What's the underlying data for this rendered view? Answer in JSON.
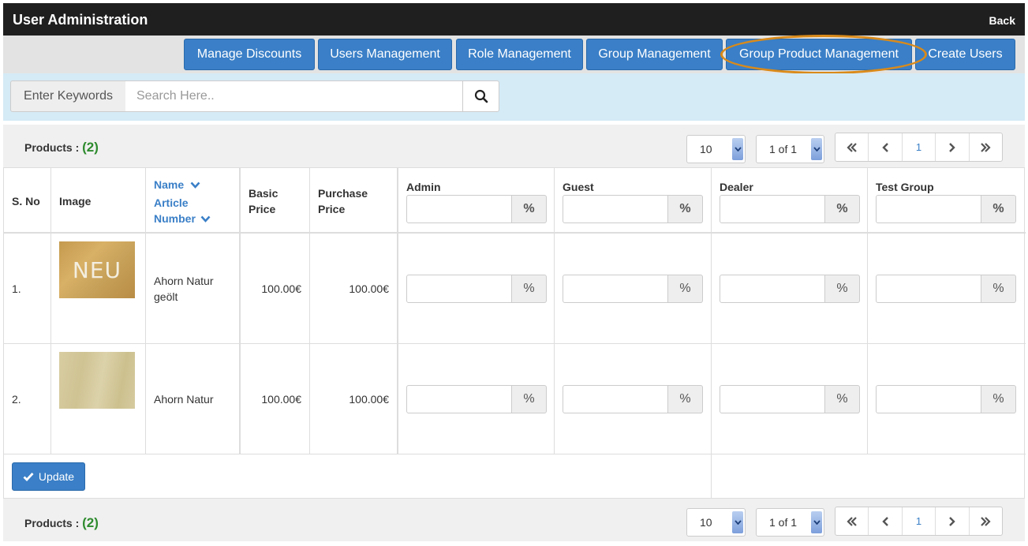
{
  "header": {
    "title": "User Administration",
    "back_label": "Back"
  },
  "nav": {
    "buttons": [
      {
        "label": "Manage Discounts"
      },
      {
        "label": "Users Management"
      },
      {
        "label": "Role Management"
      },
      {
        "label": "Group Management"
      },
      {
        "label": "Group Product Management"
      },
      {
        "label": "Create Users"
      }
    ],
    "highlighted": "Group Product Management",
    "highlight_color": "#d98a1a",
    "button_color": "#3a7fc7"
  },
  "search": {
    "label": "Enter Keywords",
    "placeholder": "Search Here..",
    "value": "",
    "icon": "search-icon"
  },
  "products": {
    "label": "Products :",
    "count": "(2)",
    "per_page": "10",
    "page_of": "1 of 1",
    "current_page": "1"
  },
  "table": {
    "columns": {
      "sno": "S. No",
      "image": "Image",
      "name": "Name",
      "article_number": "Article Number",
      "basic_price": "Basic Price",
      "purchase_price": "Purchase Price"
    },
    "groups": [
      "Admin",
      "Guest",
      "Dealer",
      "Test Group"
    ],
    "percent_symbol": "%",
    "rows": [
      {
        "sno": "1.",
        "image_text": "NEU",
        "name": "Ahorn Natur geölt",
        "basic_price": "100.00€",
        "purchase_price": "100.00€"
      },
      {
        "sno": "2.",
        "image_text": "",
        "name": "Ahorn Natur",
        "basic_price": "100.00€",
        "purchase_price": "100.00€"
      }
    ]
  },
  "update_label": "Update"
}
